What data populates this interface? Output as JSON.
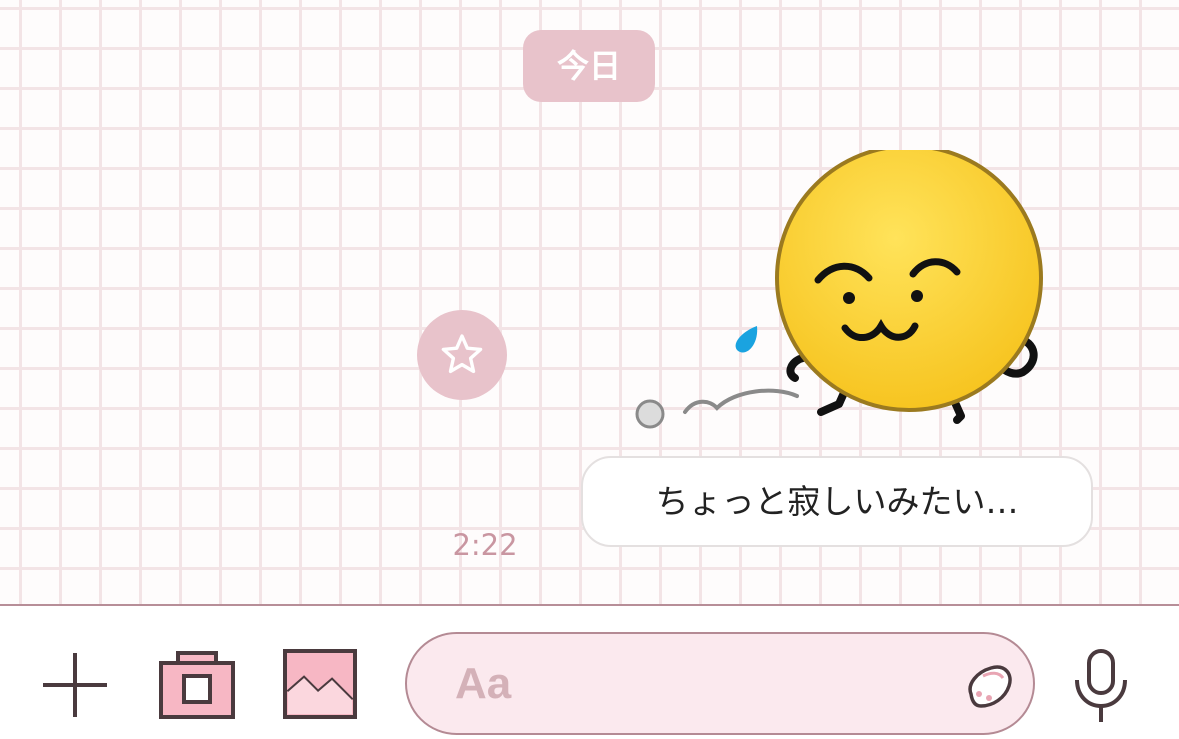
{
  "chat": {
    "date_label": "今日",
    "message": {
      "text": "ちょっと寂しいみたい…",
      "time": "2:22"
    }
  },
  "input_bar": {
    "placeholder": "Aa"
  },
  "icons": {
    "favorite": "star-icon",
    "plus": "plus-icon",
    "camera": "camera-icon",
    "image": "image-icon",
    "emoji": "emoji-icon",
    "mic": "microphone-icon"
  },
  "colors": {
    "accent_pink": "#e8c3cb",
    "bubble_border": "#e4e0e0",
    "input_fill": "#fbe9ee",
    "input_border": "#b48a94",
    "timestamp": "#c996a1"
  }
}
